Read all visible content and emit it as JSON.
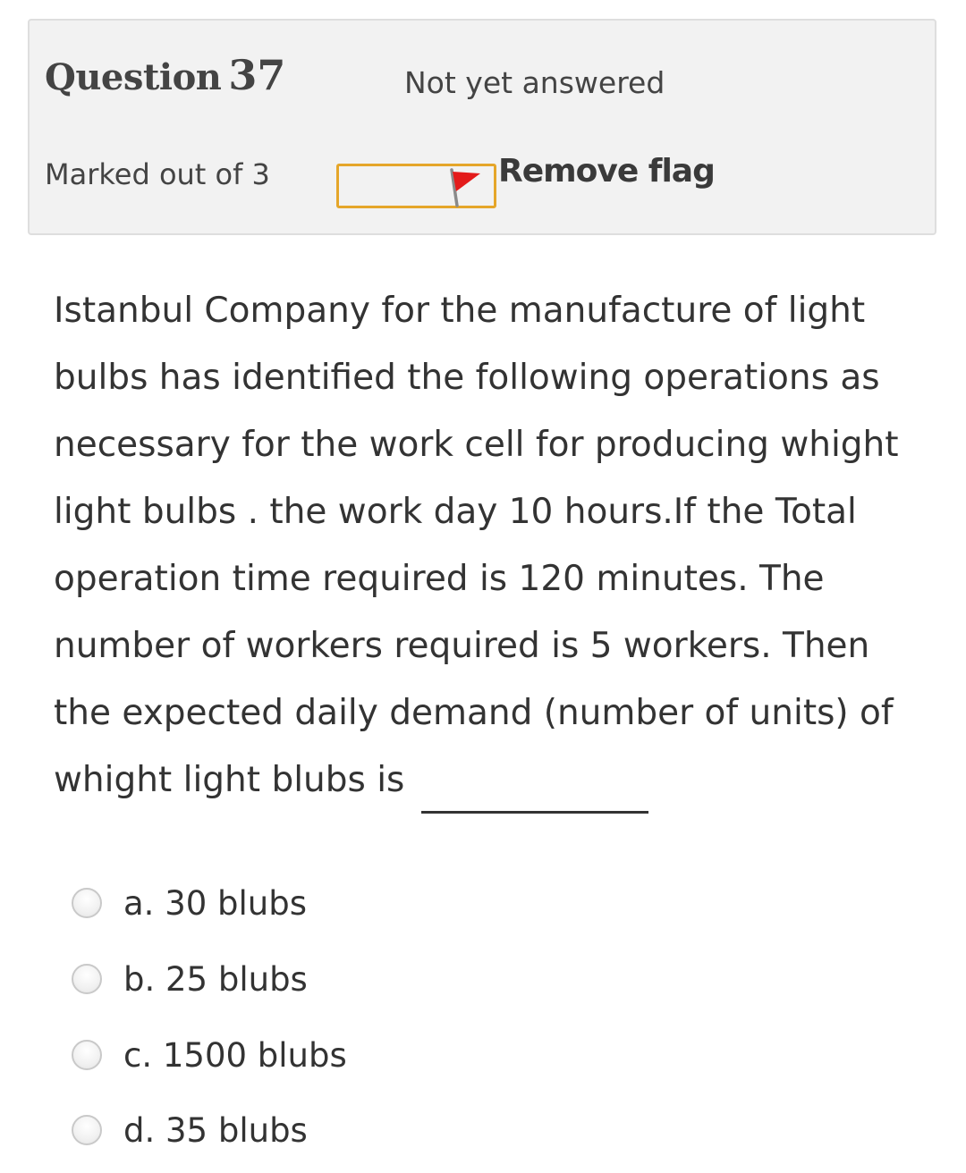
{
  "info": {
    "question_word": "Question",
    "question_number": "37",
    "state": "Not yet answered",
    "grade": "Marked out of 3",
    "flag_label": "Remove flag",
    "flag_color": "#e31b1b"
  },
  "question": {
    "lines": [
      "Istanbul Company for the manufacture of light",
      "bulbs has identified the following operations as",
      "necessary for the work cell for producing whight",
      "light bulbs . the work day 10 hours.If the Total",
      "operation time required is 120 minutes. The",
      "number of workers required is 5 workers. Then",
      "the expected daily demand (number of units) of",
      "whight light blubs is"
    ]
  },
  "answers": [
    {
      "label": "a. 30 blubs",
      "selected": false
    },
    {
      "label": "b. 25 blubs",
      "selected": false
    },
    {
      "label": "c. 1500 blubs",
      "selected": false
    },
    {
      "label": "d. 35 blubs",
      "selected": false
    }
  ]
}
